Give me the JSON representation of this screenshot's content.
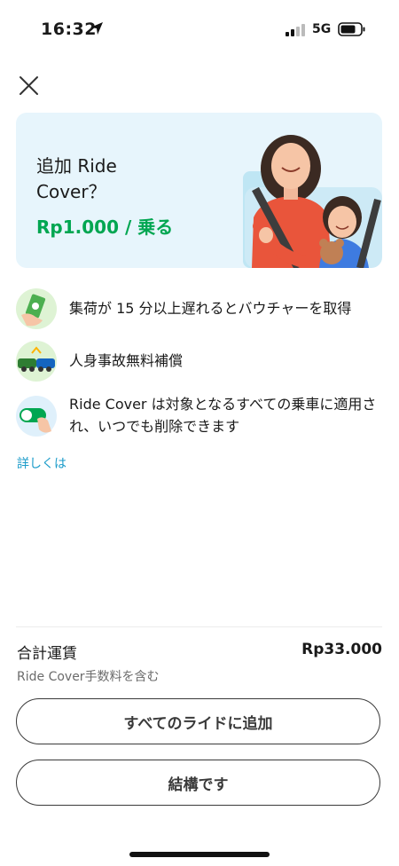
{
  "status_bar": {
    "time": "16:32",
    "network": "5G"
  },
  "banner": {
    "title": "追加 Ride Cover？",
    "title_line1": "追加 Ride",
    "title_line2": "Cover？",
    "price": "Rp1.000 / 乗る"
  },
  "benefits": [
    {
      "icon": "voucher-icon",
      "text": "集荷が 15 分以上遅れるとバウチャーを取得"
    },
    {
      "icon": "car-accident-icon",
      "text": "人身事故無料補償"
    },
    {
      "icon": "toggle-icon",
      "text": "Ride Cover は対象となるすべての乗車に適用され、いつでも削除できます"
    }
  ],
  "learn_more": "詳しくは",
  "fare": {
    "label": "合計運賃",
    "value": "Rp33.000",
    "note": "Ride Cover手数料を含む"
  },
  "buttons": {
    "add_all": "すべてのライドに追加",
    "decline": "結構です"
  },
  "colors": {
    "accent_green": "#00a651",
    "link_blue": "#1a9bc9",
    "banner_bg": "#e7f5fc"
  }
}
